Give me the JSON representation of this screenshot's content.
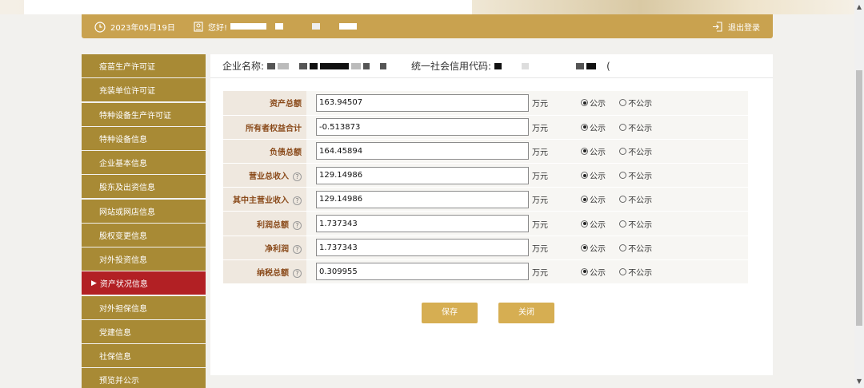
{
  "header": {
    "date": "2023年05月19日",
    "greeting": "您好!",
    "logout": "退出登录"
  },
  "sidebar": {
    "items": [
      {
        "label": "疫苗生产许可证"
      },
      {
        "label": "充装单位许可证"
      },
      {
        "label": "特种设备生产许可证"
      },
      {
        "label": "特种设备信息"
      },
      {
        "label": "企业基本信息"
      },
      {
        "label": "股东及出资信息"
      },
      {
        "label": "网站或网店信息"
      },
      {
        "label": "股权变更信息"
      },
      {
        "label": "对外投资信息"
      },
      {
        "label": "资产状况信息",
        "active": true
      },
      {
        "label": "对外担保信息"
      },
      {
        "label": "党建信息"
      },
      {
        "label": "社保信息"
      },
      {
        "label": "预览并公示"
      }
    ]
  },
  "company": {
    "name_label": "企业名称:",
    "code_label": "统一社会信用代码:",
    "code_tail": "("
  },
  "finance": {
    "unit": "万元",
    "public": "公示",
    "not_public": "不公示",
    "rows": [
      {
        "label": "资产总额",
        "value": "163.94507",
        "help": false
      },
      {
        "label": "所有者权益合计",
        "value": "-0.513873",
        "help": false
      },
      {
        "label": "负债总额",
        "value": "164.45894",
        "help": false
      },
      {
        "label": "营业总收入",
        "value": "129.14986",
        "help": true
      },
      {
        "label": "其中主营业收入",
        "value": "129.14986",
        "help": true
      },
      {
        "label": "利润总额",
        "value": "1.737343",
        "help": true
      },
      {
        "label": "净利润",
        "value": "1.737343",
        "help": true
      },
      {
        "label": "纳税总额",
        "value": "0.309955",
        "help": true
      }
    ]
  },
  "buttons": {
    "save": "保存",
    "close": "关闭"
  },
  "icons": {
    "clock": "clock-icon",
    "user": "user-icon",
    "logout": "logout-icon",
    "help": "question-icon"
  },
  "colors": {
    "accent": "#c9a24f",
    "sidebar": "#a88a35",
    "active": "#b22024"
  }
}
